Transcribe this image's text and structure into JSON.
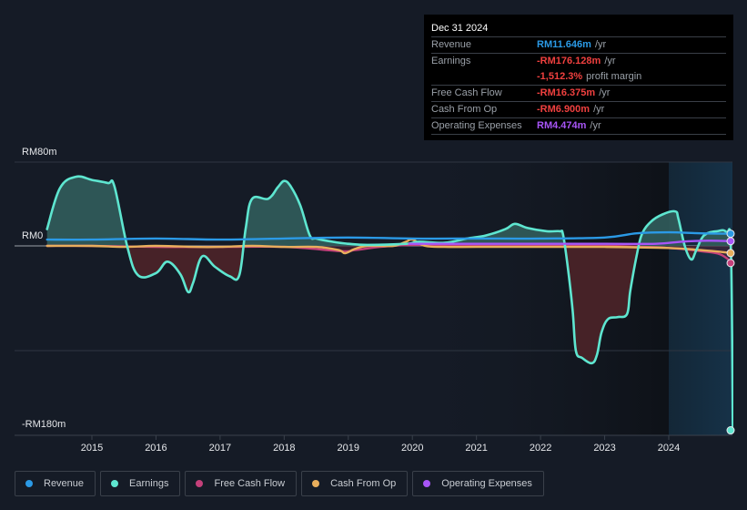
{
  "tooltip": {
    "date": "Dec 31 2024",
    "rows": [
      {
        "label": "Revenue",
        "value": "RM11.646m",
        "unit": "/yr",
        "color": "#2b9ae6"
      },
      {
        "label": "Earnings",
        "value": "-RM176.128m",
        "unit": "/yr",
        "color": "#f0403f"
      },
      {
        "label": "",
        "value": "-1,512.3%",
        "unit": "profit margin",
        "color": "#f0403f"
      },
      {
        "label": "Free Cash Flow",
        "value": "-RM16.375m",
        "unit": "/yr",
        "color": "#f0403f"
      },
      {
        "label": "Cash From Op",
        "value": "-RM6.900m",
        "unit": "/yr",
        "color": "#f0403f"
      },
      {
        "label": "Operating Expenses",
        "value": "RM4.474m",
        "unit": "/yr",
        "color": "#a855f7"
      }
    ]
  },
  "legend": [
    {
      "label": "Revenue",
      "color": "#2b9ae6"
    },
    {
      "label": "Earnings",
      "color": "#5ee6d0"
    },
    {
      "label": "Free Cash Flow",
      "color": "#c4407a"
    },
    {
      "label": "Cash From Op",
      "color": "#e8ae5c"
    },
    {
      "label": "Operating Expenses",
      "color": "#a855f7"
    }
  ],
  "chart_data": {
    "type": "line",
    "title": "",
    "xlabel": "",
    "ylabel": "",
    "y_unit": "RM m",
    "ylim": [
      -180,
      80
    ],
    "y_tick_labels": [
      {
        "value": 80,
        "label": "RM80m"
      },
      {
        "value": 0,
        "label": "RM0"
      },
      {
        "value": -180,
        "label": "-RM180m"
      }
    ],
    "gridlines": [
      80,
      0,
      -100
    ],
    "x_ticks": [
      2015,
      2016,
      2017,
      2018,
      2019,
      2020,
      2021,
      2022,
      2023,
      2024
    ],
    "xlim": [
      2014.3,
      2025.0
    ],
    "highlight_from": 2024.0,
    "series": [
      {
        "name": "Revenue",
        "color": "#2b9ae6",
        "area": false,
        "points": [
          [
            2014.3,
            6
          ],
          [
            2015,
            6
          ],
          [
            2016,
            7
          ],
          [
            2017,
            6
          ],
          [
            2018,
            7
          ],
          [
            2019,
            8
          ],
          [
            2020,
            7
          ],
          [
            2021,
            7
          ],
          [
            2022,
            7
          ],
          [
            2023,
            8
          ],
          [
            2023.5,
            12
          ],
          [
            2024,
            13
          ],
          [
            2024.5,
            12
          ],
          [
            2025,
            11.6
          ]
        ]
      },
      {
        "name": "Earnings",
        "color": "#5ee6d0",
        "area": true,
        "points": [
          [
            2014.3,
            16
          ],
          [
            2014.5,
            55
          ],
          [
            2014.75,
            66
          ],
          [
            2015,
            63
          ],
          [
            2015.25,
            60
          ],
          [
            2015.35,
            57
          ],
          [
            2015.55,
            0
          ],
          [
            2015.72,
            -28
          ],
          [
            2016,
            -26
          ],
          [
            2016.18,
            -15
          ],
          [
            2016.38,
            -27
          ],
          [
            2016.5,
            -44
          ],
          [
            2016.58,
            -35
          ],
          [
            2016.72,
            -10
          ],
          [
            2016.92,
            -20
          ],
          [
            2017.15,
            -29
          ],
          [
            2017.3,
            -28
          ],
          [
            2017.4,
            17
          ],
          [
            2017.5,
            45
          ],
          [
            2017.75,
            45
          ],
          [
            2017.9,
            56
          ],
          [
            2018.0,
            62
          ],
          [
            2018.1,
            57
          ],
          [
            2018.25,
            39
          ],
          [
            2018.4,
            10
          ],
          [
            2018.5,
            7
          ],
          [
            2018.75,
            4
          ],
          [
            2019,
            2
          ],
          [
            2019.3,
            1
          ],
          [
            2019.9,
            2
          ],
          [
            2020.1,
            4
          ],
          [
            2020.5,
            3
          ],
          [
            2020.85,
            7
          ],
          [
            2021.15,
            10
          ],
          [
            2021.45,
            16
          ],
          [
            2021.6,
            21
          ],
          [
            2021.8,
            17
          ],
          [
            2022.1,
            14
          ],
          [
            2022.3,
            14
          ],
          [
            2022.35,
            11
          ],
          [
            2022.42,
            -18
          ],
          [
            2022.5,
            -61
          ],
          [
            2022.55,
            -100
          ],
          [
            2022.65,
            -107
          ],
          [
            2022.8,
            -112
          ],
          [
            2022.88,
            -104
          ],
          [
            2022.95,
            -83
          ],
          [
            2023.05,
            -70
          ],
          [
            2023.2,
            -68
          ],
          [
            2023.35,
            -65
          ],
          [
            2023.4,
            -43
          ],
          [
            2023.5,
            -9
          ],
          [
            2023.58,
            11
          ],
          [
            2023.72,
            23
          ],
          [
            2023.9,
            30
          ],
          [
            2024.1,
            33
          ],
          [
            2024.15,
            26
          ],
          [
            2024.25,
            0
          ],
          [
            2024.35,
            -13
          ],
          [
            2024.43,
            -4
          ],
          [
            2024.55,
            10
          ],
          [
            2024.75,
            14
          ],
          [
            2024.9,
            13
          ],
          [
            2024.97,
            -4
          ],
          [
            2025.0,
            -176.1
          ]
        ]
      },
      {
        "name": "Free Cash Flow",
        "color": "#c4407a",
        "area": true,
        "points": [
          [
            2014.3,
            0
          ],
          [
            2015,
            0
          ],
          [
            2016,
            -1
          ],
          [
            2017,
            -1
          ],
          [
            2018,
            -1
          ],
          [
            2018.9,
            -5
          ],
          [
            2019.1,
            -4
          ],
          [
            2019.5,
            -1
          ],
          [
            2020,
            1
          ],
          [
            2021,
            0
          ],
          [
            2022,
            0
          ],
          [
            2023,
            0
          ],
          [
            2024,
            -2
          ],
          [
            2024.5,
            -5
          ],
          [
            2024.8,
            -8
          ],
          [
            2025,
            -16.4
          ]
        ]
      },
      {
        "name": "Cash From Op",
        "color": "#e8ae5c",
        "area": false,
        "points": [
          [
            2014.3,
            0
          ],
          [
            2015,
            0
          ],
          [
            2015.5,
            -1
          ],
          [
            2016,
            0
          ],
          [
            2016.6,
            -1
          ],
          [
            2017,
            -1
          ],
          [
            2017.5,
            0
          ],
          [
            2018,
            -1
          ],
          [
            2018.5,
            -1
          ],
          [
            2018.85,
            -4
          ],
          [
            2018.95,
            -7
          ],
          [
            2019.1,
            -3
          ],
          [
            2019.3,
            0
          ],
          [
            2019.7,
            0
          ],
          [
            2019.9,
            4
          ],
          [
            2020.0,
            6
          ],
          [
            2020.2,
            0
          ],
          [
            2020.5,
            -1
          ],
          [
            2021,
            -1
          ],
          [
            2022,
            -1
          ],
          [
            2023,
            -1
          ],
          [
            2024,
            -2
          ],
          [
            2024.5,
            -4
          ],
          [
            2025,
            -6.9
          ]
        ]
      },
      {
        "name": "Operating Expenses",
        "color": "#a855f7",
        "area": false,
        "points": [
          [
            2019.95,
            2
          ],
          [
            2020.5,
            2
          ],
          [
            2021,
            2
          ],
          [
            2022,
            2
          ],
          [
            2023,
            2
          ],
          [
            2023.8,
            2
          ],
          [
            2024.2,
            4
          ],
          [
            2024.6,
            5
          ],
          [
            2025,
            4.5
          ]
        ]
      }
    ]
  }
}
